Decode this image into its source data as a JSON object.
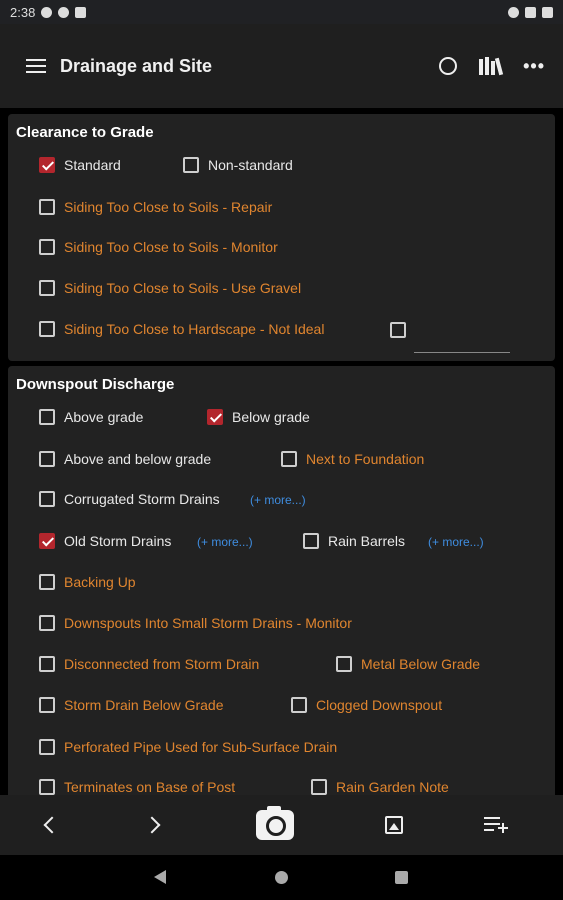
{
  "status_bar": {
    "time": "2:38"
  },
  "app_bar": {
    "title": "Drainage and Site",
    "icons": [
      "menu-icon",
      "circle-icon",
      "library-icon",
      "more-icon"
    ]
  },
  "sections": {
    "clearance": {
      "title": "Clearance to Grade",
      "items": [
        {
          "label": "Standard",
          "checked": true
        },
        {
          "label": "Non-standard",
          "checked": false
        },
        {
          "label": "Siding Too Close to Soils - Repair",
          "checked": false
        },
        {
          "label": "Siding Too Close to Soils - Monitor",
          "checked": false
        },
        {
          "label": "Siding Too Close to Soils - Use Gravel",
          "checked": false
        },
        {
          "label": "Siding Too Close to Hardscape - Not Ideal",
          "checked": false
        }
      ],
      "extra_checkbox_checked": false,
      "extra_input_value": ""
    },
    "downspout": {
      "title": "Downspout Discharge",
      "more_label": "(+ more...)",
      "items": [
        {
          "label": "Above grade",
          "checked": false
        },
        {
          "label": "Below grade",
          "checked": true
        },
        {
          "label": "Above and below grade",
          "checked": false
        },
        {
          "label": "Next to Foundation",
          "checked": false
        },
        {
          "label": "Corrugated Storm Drains",
          "checked": false
        },
        {
          "label": "Old Storm Drains",
          "checked": true
        },
        {
          "label": "Rain Barrels",
          "checked": false
        },
        {
          "label": "Backing Up",
          "checked": false
        },
        {
          "label": "Downspouts Into Small Storm Drains - Monitor",
          "checked": false
        },
        {
          "label": "Disconnected from Storm Drain",
          "checked": false
        },
        {
          "label": "Metal Below Grade",
          "checked": false
        },
        {
          "label": "Storm Drain Below Grade",
          "checked": false
        },
        {
          "label": "Clogged Downspout",
          "checked": false
        },
        {
          "label": "Perforated Pipe Used for Sub-Surface Drain",
          "checked": false
        },
        {
          "label": "Terminates on Base of Post",
          "checked": false
        },
        {
          "label": "Rain Garden Note",
          "checked": false
        }
      ]
    }
  },
  "bottom_bar": {
    "icons": [
      "back-chevron-icon",
      "forward-chevron-icon",
      "camera-icon",
      "gallery-icon",
      "add-list-icon"
    ]
  },
  "colors": {
    "accent_checked": "#b3262d",
    "orange_label": "#e0852f",
    "link_blue": "#3f8de0",
    "panel_bg": "#222222"
  }
}
